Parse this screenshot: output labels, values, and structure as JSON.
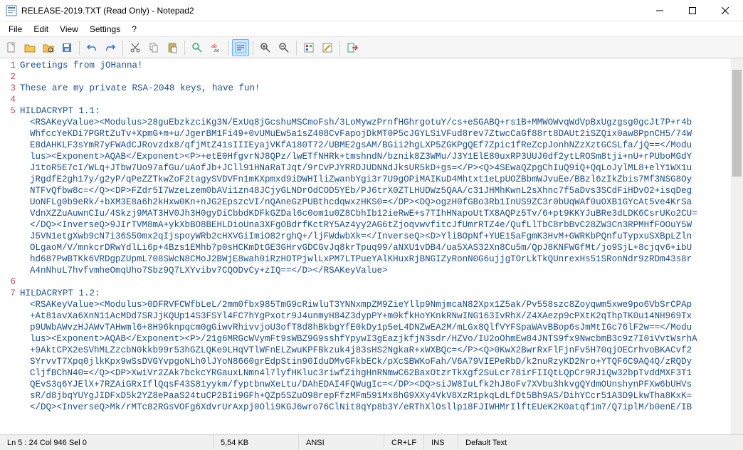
{
  "window": {
    "title": "RELEASE-2019.TXT (Read Only) - Notepad2"
  },
  "menus": {
    "file": "File",
    "edit": "Edit",
    "view": "View",
    "settings": "Settings",
    "help": "?"
  },
  "lines": [
    {
      "num": "1",
      "text": "Greetings from jOHanna!",
      "wrap": []
    },
    {
      "num": "2",
      "text": "",
      "wrap": []
    },
    {
      "num": "3",
      "text": "These are my private RSA-2048 keys, have fun!",
      "wrap": []
    },
    {
      "num": "4",
      "text": "",
      "wrap": []
    },
    {
      "num": "5",
      "text": "HILDACRYPT 1.1:",
      "wrap": [
        "<RSAKeyValue><Modulus>28guEbzkzciKg3N/ExUq8jGcshuMSCmoFsh/3LoMywzPrnfHGhrgotuY/cs+eSGABQ+rs1B+MMWOWvqWdVpBxUgzgsg0gcJt7P+r4b",
        "WhfccYeKDi7PGRtZuTv+XpmG+m+u/JgerBM1Fi49+0vUMuEw5a1sZ408CvFapojDkMT0P5cJGYLSiVFud8rev7ZtwcCaGf88rt8DAUt2iSZQix0aw8PpnCH5/74W",
        "E8dAHKLF3sYmR7yFWAdCJRovzdx8/qfjMtZ41sIIIEyajVKfA180T72/UBME2gsAM/BGii2hgLXP5ZGKPgQEf7Zpic1fReZcpJonhNZzXztGCSLfa/jQ==</Modu",
        "lus><Exponent>AQAB</Exponent><P>+etE0HfgvrNJ8QPz/lwETfNHRk+tmshndN/bznik8Z3WMu/J3Y1ElE80uxRP3UUJ0df2ytLROSm8tji+nU+rPUboMGdY",
        "J1toR5E7cI/WLq+JTbw7Uo97afGu/uAofJb+JCll91HNaRaTJqt/9rCvPJYRRDJUDNNdJksUR5kD+gs=</P><Q>4SEwaQZpgChIuQ9iQ+QqLoJylML8+elY1WX1u",
        "jRgdfE2gh17y/g2yP/qPeZZTkwZoF2tagySVDVFn1mKXpmxd9iDWHIliZwanbYgi3r7U9gOPiMAIKuD4Mhtxt1eLpUOZBbmWJvuEe/BBzl6zIkZbis7Mf3NSG8Oy",
        "NTFvQfbw8c=</Q><DP>FZdr5I7WzeLzem0bAVi1zn48JCjyGLNDrOdCOD5YEb/PJ6trX0ZTLHUDWz5QAA/c31JHMhKwnL2sXhnc7f5aDvs3SCdFiHDvO2+isqDeg",
        "UoNFLg0b9eRk/+bXM3E8a6h2kHxw0Kn+nJG2EpszcVI/nQAneGzPUBthcdqwxzHKS0=</DP><DQ>ogzH0fGBo3Rb1InUS9ZC3r0bUqWAf0uOXB1GYcAt5ve4KrSa",
        "VdnXZZuAuwnCIu/4Skzj9MAT3HV0Jh3H0gyDiCbbdKDFkGZDal6c0om1u0Z8CbhIb12ieRwE+s7TIhHNapoUtTX8AQPz5Tv/6+pt9KKYJuBRe3dLDK6CsrUKo2CU=",
        "</DQ><InverseQ>9JIrTVM8mA+ykXbBO8BEHLDioUna3XFgOBdrfKctRY5Az4yy2AG6tZjoqvwvfitcJfUmrRTZ4e/QufLlTbC8rbBvC28ZW3Cn3RPMHfFOOuY5W",
        "J5VN1etgXwb9cN7i36S50mx2qIjspoyWRb2cHXVGiImiO82rghQ+/ljFWdwbXk=</InverseQ><D>YliBOpNf+YUE15aFgmK3HvM+GWRKbPQnfuTypxuSXBpLZln",
        "OLgaoM/V/mnkcrDRwYdlLi6p+4Bzs1EMhb7p0sHCKmDtGE3GHrvGDCGvJq8krTpuq99/aNXU1vDB4/ua5XAS32Xn8Cu5m/QpJ8KNFWGfMt/jo9SjL+8cjqv6+ibU",
        "hd687PwBTKk6VRDgpZUpmL708SWcN8CMoJ2BWjE8wah0iRzHOTPjwlLxPM7LTPueYAlKHuxRjBNGIZyRonN0G6ujjgTOrLkTkQUnrexHs51SRonNdr9zRDm43s8r",
        "A4nNhuL7hvfvmheOmqUho7Sbz9Q7LXYvibv7CQODvCy+zIQ==</D></RSAKeyValue>"
      ]
    },
    {
      "num": "6",
      "text": "",
      "wrap": []
    },
    {
      "num": "7",
      "text": "HILDACRYPT 1.2:",
      "wrap": [
        "<RSAKeyValue><Modulus>0DFRVFCWfbLeL/2mm0fbx985TmG9cRiwluT3YNNxmpZM9ZieYllp9NmjmcaN82Xpx1Z5ak/Pv558szc8Zoyqwm5xwe9po6VbSrCPAp",
        "+At81avXa6XnN11AcMDd7SRJjKQUp14S3FSYl4FC7hYgPxotr9J4unmyH84Z3dypPY+m0kfkHoYKnkRNwING163IvRhX/Z4XAezp9cPXtK2qThpTK0u14NH969Tx",
        "p9UWbAWvzHJAWvTAHwml6+8H96knpqcm0gGiwvRhivvjoU3ofT8d8hBkbgYfE0kDy1p5eL4DNZwEA2M/mLGx8QlfVYFSpaWAvBBop6sJmMtIGc76lF2w==</Modu",
        "lus><Exponent>AQAB</Exponent><P>/21g6MRGcWVymFt9sWBZ9G9sshfYpywI3gEazjkfjN3sdr/HZVo/IU2oOhmEw84JNTS9fx9NwcbmB3c9z7I0iVvtWsrhA",
        "+9AktCPX2eSVhMLZzcbN0kkb99r53hGZLQKe9LHqVTlWFnELZwuKPFBkzuk4j83sHS2NgkaR+xWXBQc=</P><Q>0KwX2BwrRxFlFjnFv5H70qjOECrhvoBKACvf2",
        "SYrvvT7Xpq0jlkKpx9wSsDVGYvpgoNLh0lJYoN8660grEdpStin90IduDMvGFkbECk/pXcSBWKoFah/V6A79VIEPeRbD/k2nuRzyKD2Nro+YTQF6C9AQ4Q/zRQDy",
        "CljfBChN40=</Q><DP>XwiVr2ZAk7bckcYRGauxLNmn4l7lyfHKluc3riwfZihgHnRNmwC62BaxOtzrTkXgf2SuLcr78irFIIQtLQpCr9RJiQw32bpTvddMXF3T1",
        "QEvS3q6YJElX+7RZAiGRxIflQqsF43S81yykm/fyptbnwXeLtu/DAhEDAI4FQWugIc=</DP><DQ>siJW8IuLfk2hJ8oFv7XVbu3hkvgQYdmOUnshynPFXw6bUHVs",
        "sR/d8jbqYUYgJIDFxD5k2YZ8ePaaS24tuCP2BIi9GFh+QZp5SZuO98repFfzMFm591Mx8hG9XXy4VkV8XzR1pkqLdLfDt5Bh9AS/DihYCcr51A3D9LkwTha8KxK=",
        "</DQ><InverseQ>Mk/rMTc82RGsVOFg6XdvrUrAxpj0Oli9KGJ6wro76ClNit8qYp8b3Y/eRThXlOsllp18FJIWHMrIlftEUeK2K0atqf1m7/Q7iplM/b0enE/IB"
      ]
    }
  ],
  "status": {
    "pos": "Ln 5 : 24   Col 946   Sel 0",
    "size": "5,54 KB",
    "encoding": "ANSI",
    "lineend": "CR+LF",
    "mode": "INS",
    "scheme": "Default Text"
  }
}
